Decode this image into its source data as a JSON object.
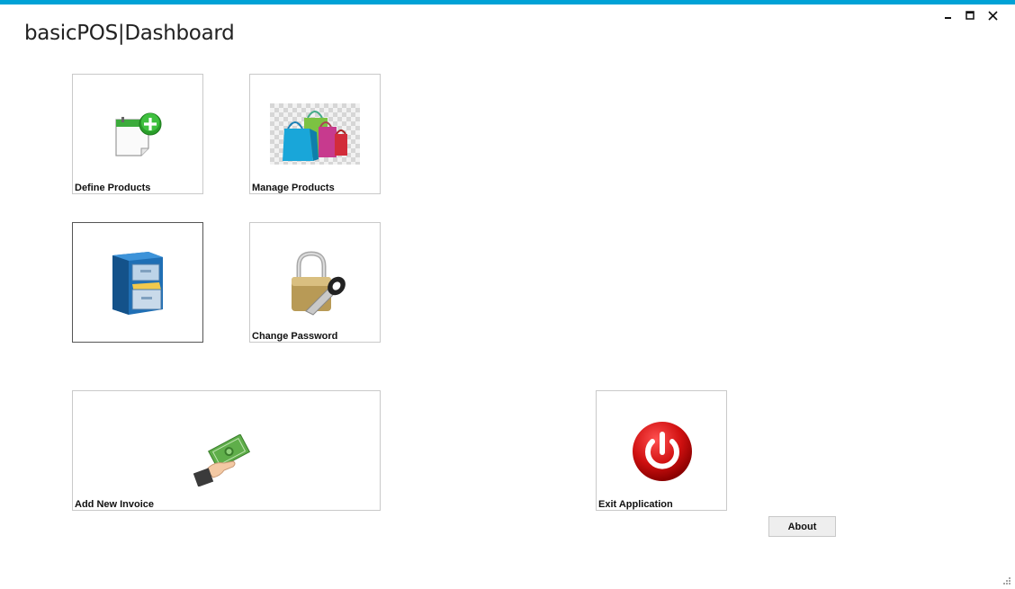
{
  "window": {
    "title": "basicPOS|Dashboard",
    "controls": {
      "minimize": "–",
      "maximize": "☐",
      "close": "✕"
    }
  },
  "tiles": {
    "define_products": {
      "label": "Define Products",
      "icon": "calendar-add-icon"
    },
    "manage_products": {
      "label": "Manage Products",
      "icon": "shopping-bags-icon"
    },
    "file_cabinet": {
      "label": "",
      "icon": "file-cabinet-icon"
    },
    "change_password": {
      "label": "Change Password",
      "icon": "padlock-key-icon"
    },
    "add_invoice": {
      "label": "Add New Invoice",
      "icon": "money-hand-icon"
    },
    "exit_app": {
      "label": "Exit Application",
      "icon": "power-icon"
    }
  },
  "about": {
    "label": "About"
  },
  "colors": {
    "accent": "#00a2d6",
    "tile_border": "#c9c9c9",
    "power_red": "#d01010"
  }
}
